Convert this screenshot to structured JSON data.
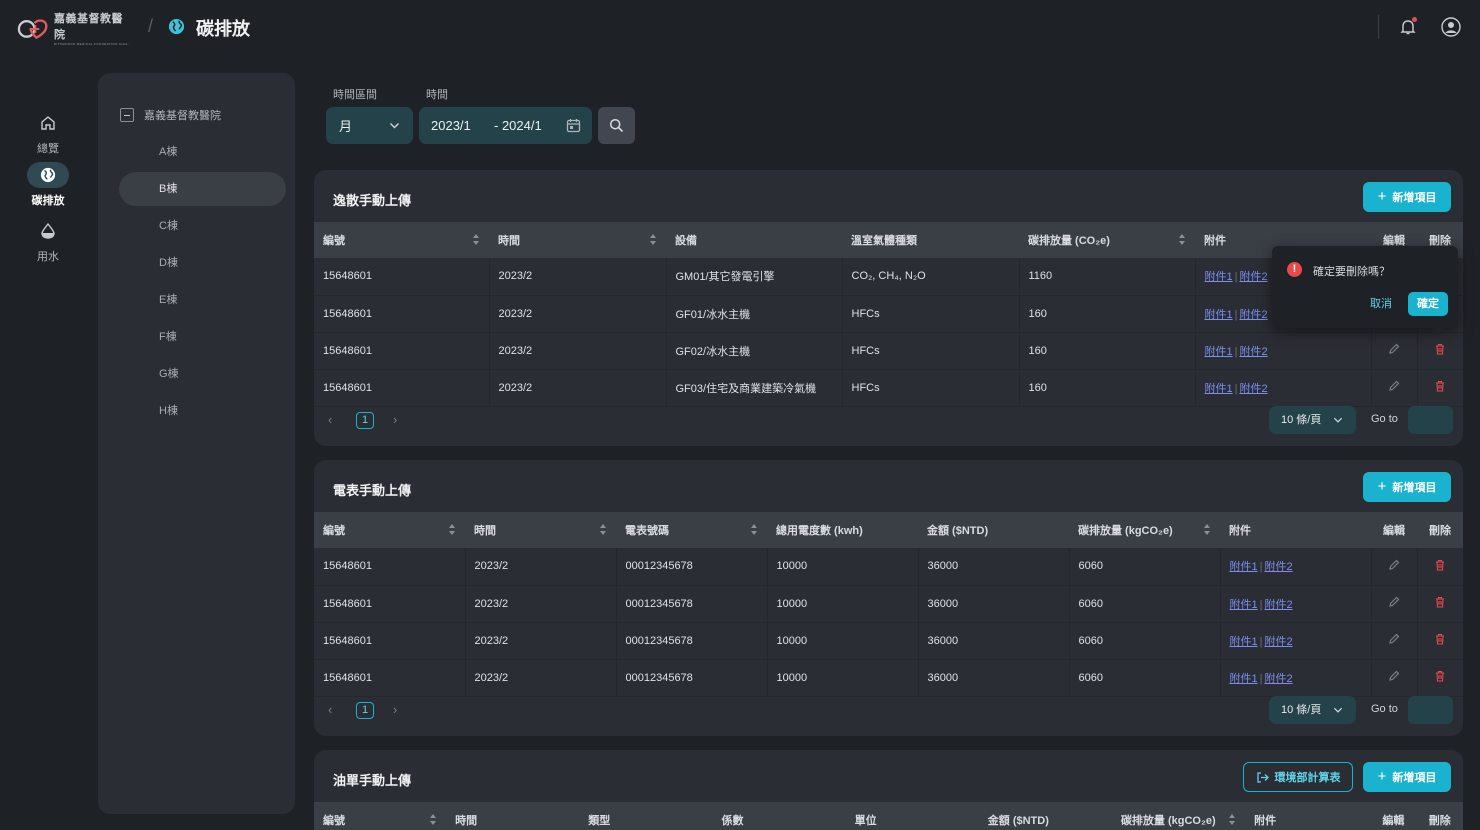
{
  "header": {
    "logo_cn": "嘉義基督教醫院",
    "logo_en": "DITMANSON MEDICAL FOUNDATION CHIA-YI CHRISTIAN HOSPITAL",
    "page_title": "碳排放",
    "icons": [
      "globe-icon",
      "bell-icon",
      "user-icon"
    ]
  },
  "rail": [
    {
      "label": "總覽",
      "icon": "home-icon",
      "active": false
    },
    {
      "label": "碳排放",
      "icon": "globe-icon",
      "active": true
    },
    {
      "label": "用水",
      "icon": "water-drop-icon",
      "active": false
    }
  ],
  "tree": {
    "root": "嘉義基督教醫院",
    "items": [
      "A棟",
      "B棟",
      "C棟",
      "D棟",
      "E棟",
      "F棟",
      "G棟",
      "H棟"
    ],
    "active_index": 1
  },
  "filters": {
    "period_label": "時間區間",
    "period_value": "月",
    "time_label": "時間",
    "start": "2023/1",
    "end": "- 2024/1"
  },
  "fugitive": {
    "title": "逸散手動上傳",
    "add_label": "新增項目",
    "columns": [
      "編號",
      "時間",
      "設備",
      "溫室氣體種類",
      "碳排放量 (CO₂e)",
      "附件",
      "編輯",
      "刪除"
    ],
    "rows": [
      {
        "id": "15648601",
        "time": "2023/2",
        "device": "GM01/其它發電引擎",
        "gas": "CO₂, CH₄, N₂O",
        "emission": "1160"
      },
      {
        "id": "15648601",
        "time": "2023/2",
        "device": "GF01/冰水主機",
        "gas": "HFCs",
        "emission": "160"
      },
      {
        "id": "15648601",
        "time": "2023/2",
        "device": "GF02/冰水主機",
        "gas": "HFCs",
        "emission": "160"
      },
      {
        "id": "15648601",
        "time": "2023/2",
        "device": "GF03/住宅及商業建築冷氣機",
        "gas": "HFCs",
        "emission": "160"
      }
    ]
  },
  "meter": {
    "title": "電表手動上傳",
    "add_label": "新增項目",
    "columns": [
      "編號",
      "時間",
      "電表號碼",
      "總用電度數 (kwh)",
      "金額 ($NTD)",
      "碳排放量 (kgCO₂e)",
      "附件",
      "編輯",
      "刪除"
    ],
    "rows": [
      {
        "id": "15648601",
        "time": "2023/2",
        "meter": "00012345678",
        "kwh": "10000",
        "amount": "36000",
        "emission": "6060"
      },
      {
        "id": "15648601",
        "time": "2023/2",
        "meter": "00012345678",
        "kwh": "10000",
        "amount": "36000",
        "emission": "6060"
      },
      {
        "id": "15648601",
        "time": "2023/2",
        "meter": "00012345678",
        "kwh": "10000",
        "amount": "36000",
        "emission": "6060"
      },
      {
        "id": "15648601",
        "time": "2023/2",
        "meter": "00012345678",
        "kwh": "10000",
        "amount": "36000",
        "emission": "6060"
      }
    ]
  },
  "oil": {
    "title": "油單手動上傳",
    "calc_label": "環境部計算表",
    "add_label": "新增項目",
    "columns": [
      "編號",
      "時間",
      "類型",
      "係數",
      "單位",
      "金額 ($NTD)",
      "碳排放量 (kgCO₂e)",
      "附件",
      "編輯",
      "刪除"
    ]
  },
  "attachments": {
    "a1": "附件1",
    "a2": "附件2",
    "sep": "|"
  },
  "pager": {
    "page": "1",
    "size_label": "10 條/頁",
    "goto_label": "Go to"
  },
  "popconfirm": {
    "text": "確定要刪除嗎？",
    "cancel": "取消",
    "ok": "確定",
    "icon": "!"
  },
  "colors": {
    "accent": "#1ab3cf",
    "danger": "#e84a4a",
    "link": "#7b8ff0",
    "surface": "#2a2d33",
    "background": "#1e2126"
  }
}
